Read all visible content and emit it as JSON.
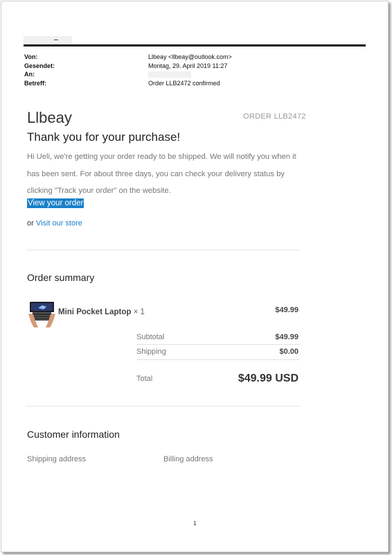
{
  "email_header": {
    "from_label": "Von:",
    "from_value": "Llbeay <llbeay@outlook.com>",
    "sent_label": "Gesendet:",
    "sent_value": "Montag, 29. April 2019 11:27",
    "to_label": "An:",
    "subject_label": "Betreff:",
    "subject_value": "Order LLB2472 confirmed"
  },
  "store": {
    "name": "Llbeay",
    "order_number": "ORDER LLB2472"
  },
  "message": {
    "heading": "Thank you for your purchase!",
    "body": "Hi Ueli, we're getting your order ready to be shipped. We will notify you when it has been sent. For about three days, you can check your delivery status by clicking \"Track your order\" on the website.",
    "view_order_label": "View your order",
    "or_text": "or ",
    "visit_store_label": "Visit our store"
  },
  "order_summary": {
    "title": "Order summary",
    "item": {
      "name": "Mini Pocket Laptop",
      "quantity": "× 1",
      "price": "$49.99",
      "image_icon": "laptop-product-icon"
    },
    "subtotal_label": "Subtotal",
    "subtotal_value": "$49.99",
    "shipping_label": "Shipping",
    "shipping_value": "$0.00",
    "total_label": "Total",
    "total_value": "$49.99 USD"
  },
  "customer_info": {
    "title": "Customer information",
    "shipping_address_label": "Shipping address",
    "billing_address_label": "Billing address"
  },
  "page_number": "1",
  "colors": {
    "link": "#1a80c8",
    "header_rule": "#111111",
    "muted_text": "#777777"
  }
}
